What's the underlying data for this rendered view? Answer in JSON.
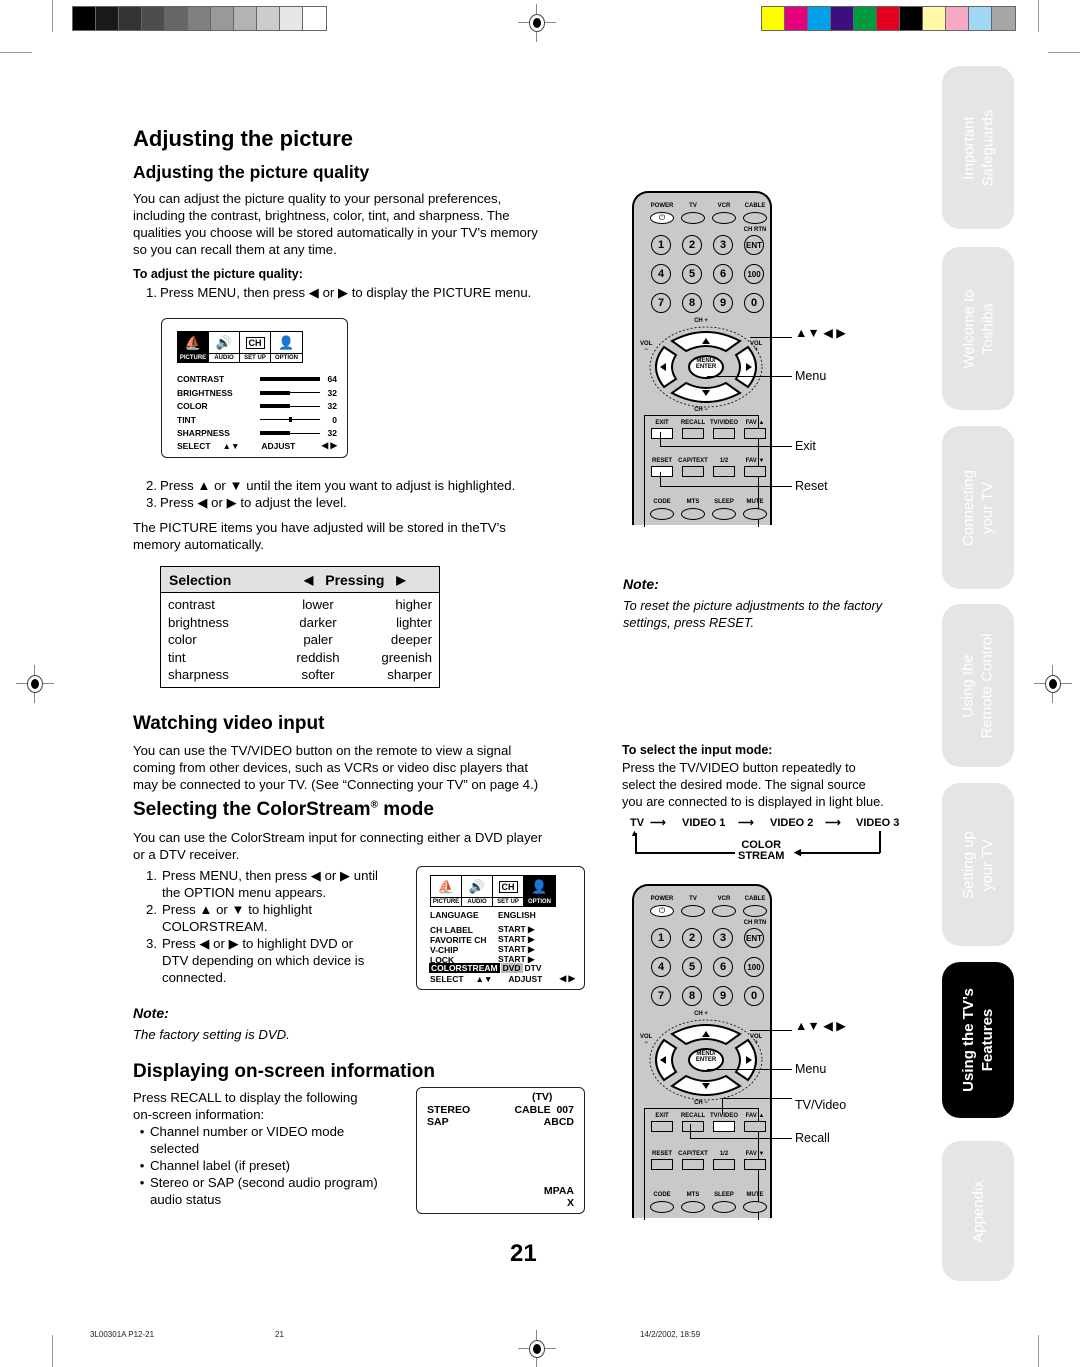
{
  "registration": {
    "grayscale": [
      "#000000",
      "#1a1a1a",
      "#333333",
      "#4d4d4d",
      "#666666",
      "#808080",
      "#999999",
      "#b3b3b3",
      "#cccccc",
      "#e6e6e6",
      "#ffffff"
    ],
    "colors": [
      "#ffff00",
      "#e6007e",
      "#00a0e9",
      "#3b0f7f",
      "#009b3e",
      "#e60020",
      "#000000",
      "#fff9a8",
      "#f7a8c3",
      "#a1d6f4",
      "#a6a6a6"
    ]
  },
  "page_title": "Adjusting the picture",
  "picture_quality": {
    "heading": "Adjusting the picture quality",
    "intro": [
      "You can adjust the picture quality to your personal preferences,",
      "including the contrast, brightness, color, tint, and sharpness. The",
      "qualities you choose will be stored automatically in your TV’s memory",
      "so you can recall them at any time."
    ],
    "subheading": "To adjust the picture quality:",
    "steps": [
      {
        "n": "1.",
        "text": "Press MENU, then press ◀ or ▶ to display the PICTURE menu."
      },
      {
        "n": "2.",
        "text": "Press ▲ or ▼ until the item you want to adjust is highlighted."
      },
      {
        "n": "3.",
        "text": "Press ◀ or ▶ to adjust the level."
      }
    ],
    "outro": [
      "The PICTURE items you have adjusted will be stored in theTV’s",
      "memory automatically."
    ]
  },
  "picture_menu": {
    "tabs": [
      {
        "label": "PICTURE",
        "icon": "⛵",
        "selected": true
      },
      {
        "label": "AUDIO",
        "icon": "🔊",
        "selected": false
      },
      {
        "label": "SET UP",
        "icon": "CH",
        "selected": false
      },
      {
        "label": "OPTION",
        "icon": "👤",
        "selected": false
      }
    ],
    "items": [
      {
        "label": "CONTRAST",
        "value": "64",
        "level": 1.0,
        "centered": false
      },
      {
        "label": "BRIGHTNESS",
        "value": "32",
        "level": 0.5,
        "centered": false
      },
      {
        "label": "COLOR",
        "value": "32",
        "level": 0.5,
        "centered": false
      },
      {
        "label": "TINT",
        "value": "0",
        "level": 0.5,
        "centered": true
      },
      {
        "label": "SHARPNESS",
        "value": "32",
        "level": 0.5,
        "centered": false
      }
    ],
    "footer": {
      "select": "SELECT",
      "select_arrows": "▲▼",
      "adjust": "ADJUST",
      "adjust_arrows": "◀ ▶"
    }
  },
  "selection_table": {
    "headers": {
      "selection": "Selection",
      "left_arrow": "◀",
      "pressing": "Pressing",
      "right_arrow": "▶"
    },
    "rows": [
      {
        "item": "contrast",
        "left": "lower",
        "right": "higher"
      },
      {
        "item": "brightness",
        "left": "darker",
        "right": "lighter"
      },
      {
        "item": "color",
        "left": "paler",
        "right": "deeper"
      },
      {
        "item": "tint",
        "left": "reddish",
        "right": "greenish"
      },
      {
        "item": "sharpness",
        "left": "softer",
        "right": "sharper"
      }
    ]
  },
  "note1": {
    "heading": "Note:",
    "text": [
      "To reset the picture adjustments to the factory",
      "settings, press RESET."
    ]
  },
  "video_input": {
    "heading": "Watching video input",
    "text": [
      "You can use the TV/VIDEO button on the remote to view a signal",
      "coming from other devices, such as VCRs or video disc players that",
      "may be connected to your TV. (See “Connecting your TV” on page 4.)"
    ],
    "sub_heading": "To select the input mode:",
    "sub_text": [
      "Press the TV/VIDEO button repeatedly to",
      "select the desired mode. The signal source",
      "you are connected to is displayed in light blue."
    ],
    "cycle": [
      "TV",
      "VIDEO 1",
      "VIDEO 2",
      "VIDEO 3"
    ],
    "cycle_return": [
      "COLOR",
      "STREAM"
    ]
  },
  "colorstream": {
    "heading": "Selecting the ColorStream",
    "heading_reg": "®",
    "heading_end": " mode",
    "text": [
      "You can use the ColorStream input for connecting either a DVD player",
      "or a DTV receiver."
    ],
    "steps": [
      {
        "n": "1.",
        "lines": [
          "Press MENU, then press ◀ or ▶ until",
          "the OPTION menu appears."
        ]
      },
      {
        "n": "2.",
        "lines": [
          "Press ▲ or ▼ to highlight",
          "COLORSTREAM."
        ]
      },
      {
        "n": "3.",
        "lines": [
          "Press ◀ or ▶ to highlight DVD or",
          "DTV depending on which device is",
          "connected."
        ]
      }
    ],
    "note_heading": "Note:",
    "note_text": "The factory setting is DVD."
  },
  "option_menu": {
    "tabs": [
      {
        "label": "PICTURE",
        "icon": "⛵",
        "selected": false
      },
      {
        "label": "AUDIO",
        "icon": "🔊",
        "selected": false
      },
      {
        "label": "SET UP",
        "icon": "CH",
        "selected": false
      },
      {
        "label": "OPTION",
        "icon": "👤",
        "selected": true
      }
    ],
    "items": [
      {
        "label": "LANGUAGE",
        "value": "ENGLISH"
      },
      {
        "label": "CH LABEL",
        "value": "START ▶"
      },
      {
        "label": "FAVORITE CH",
        "value": "START ▶"
      },
      {
        "label": "V-CHIP",
        "value": "START ▶"
      },
      {
        "label": "LOCK",
        "value": "START ▶"
      }
    ],
    "highlight": {
      "label": "COLORSTREAM",
      "opt_selected": "DVD",
      "opt_other": "DTV"
    },
    "footer": {
      "select": "SELECT",
      "select_arrows": "▲▼",
      "adjust": "ADJUST",
      "adjust_arrows": "◀ ▶"
    }
  },
  "onscreen": {
    "heading": "Displaying on-screen information",
    "intro": [
      "Press RECALL to display the following",
      "on-screen information:"
    ],
    "bullets": [
      {
        "lines": [
          "Channel number or VIDEO mode",
          "selected"
        ]
      },
      {
        "lines": [
          "Channel label (if preset)"
        ]
      },
      {
        "lines": [
          "Stereo or SAP (second audio program)",
          "audio status"
        ]
      }
    ],
    "display": {
      "mode": "(TV)",
      "stereo": "STEREO",
      "sap": "SAP",
      "channel": "CABLE  007",
      "label": "ABCD",
      "rating": "MPAA",
      "rating_value": "X"
    }
  },
  "remote": {
    "top_labels": [
      "POWER",
      "TV",
      "VCR",
      "CABLE"
    ],
    "ch_rtn": "CH RTN",
    "numbers": [
      "1",
      "2",
      "3",
      "ENT",
      "4",
      "5",
      "6",
      "100",
      "7",
      "8",
      "9",
      "0"
    ],
    "ch_plus": "CH +",
    "ch_minus": "CH −",
    "vol_minus": "VOL\n−",
    "vol_plus": "VOL\n+",
    "menu_enter": [
      "MENU/",
      "ENTER"
    ],
    "row1": [
      "EXIT",
      "RECALL",
      "TV/VIDEO",
      "FAV ▲"
    ],
    "row2": [
      "RESET",
      "CAP/TEXT",
      "1/2",
      "FAV ▼"
    ],
    "row3": [
      "CODE",
      "MTS",
      "SLEEP",
      "MUTE"
    ]
  },
  "remote1_callouts": {
    "arrows": "▲▼ ◀ ▶",
    "menu": "Menu",
    "exit": "Exit",
    "reset": "Reset"
  },
  "remote2_callouts": {
    "arrows": "▲▼ ◀ ▶",
    "menu": "Menu",
    "tvvideo": "TV/Video",
    "recall": "Recall"
  },
  "side_tabs": [
    {
      "lines": [
        "Important",
        "Safeguards"
      ],
      "active": false
    },
    {
      "lines": [
        "Welcome to",
        "Toshiba"
      ],
      "active": false
    },
    {
      "lines": [
        "Connecting",
        "your TV"
      ],
      "active": false
    },
    {
      "lines": [
        "Using the",
        "Remote Control"
      ],
      "active": false
    },
    {
      "lines": [
        "Setting up",
        "your TV"
      ],
      "active": false
    },
    {
      "lines": [
        "Using the TV’s",
        "Features"
      ],
      "active": true
    },
    {
      "lines": [
        "Appendix"
      ],
      "active": false
    }
  ],
  "page_number": "21",
  "footer": {
    "code": "3L00301A P12-21",
    "page": "21",
    "date": "14/2/2002, 18:59"
  }
}
